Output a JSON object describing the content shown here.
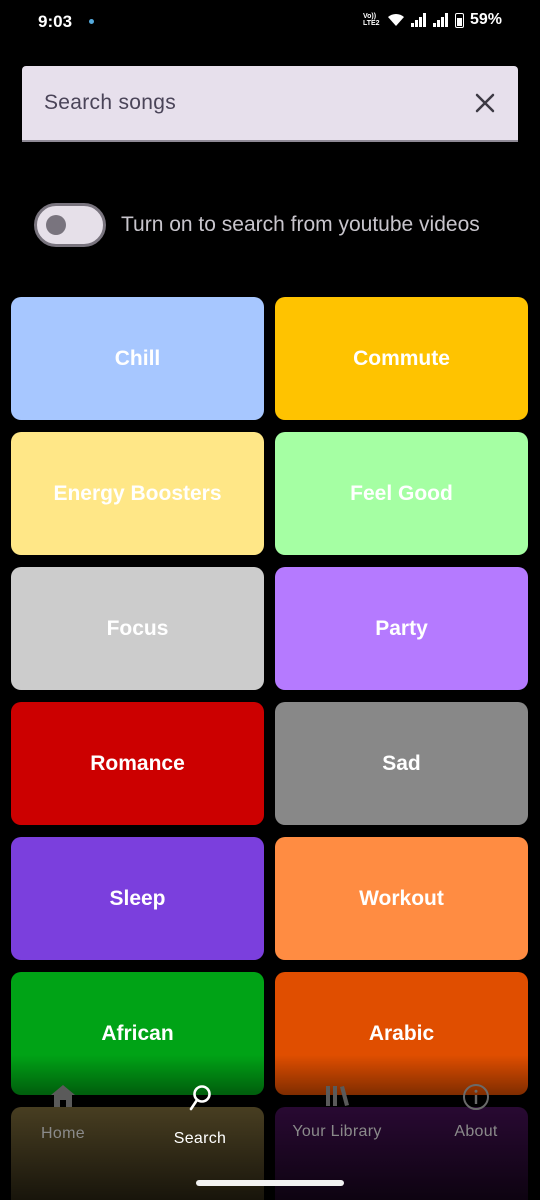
{
  "status_bar": {
    "time": "9:03",
    "network": "Vo)) LTE2",
    "battery": "59%"
  },
  "search": {
    "placeholder": "Search songs"
  },
  "youtube_toggle": {
    "label": "Turn on to search from youtube videos",
    "on": false
  },
  "genres": [
    {
      "label": "Chill",
      "color": "#a7c7ff"
    },
    {
      "label": "Commute",
      "color": "#ffc300"
    },
    {
      "label": "Energy Boosters",
      "color": "#ffe787"
    },
    {
      "label": "Feel Good",
      "color": "#a5ffa3"
    },
    {
      "label": "Focus",
      "color": "#cccccc"
    },
    {
      "label": "Party",
      "color": "#b57aff"
    },
    {
      "label": "Romance",
      "color": "#cc0000"
    },
    {
      "label": "Sad",
      "color": "#888888"
    },
    {
      "label": "Sleep",
      "color": "#7b3fdd"
    },
    {
      "label": "Workout",
      "color": "#ff8c42"
    },
    {
      "label": "African",
      "color": "#00a316"
    },
    {
      "label": "Arabic",
      "color": "#e04e00"
    },
    {
      "label": "",
      "color": "#a08a4a"
    },
    {
      "label": "",
      "color": "#5a1470"
    }
  ],
  "bottom_nav": [
    {
      "label": "Home",
      "icon": "home-icon",
      "active": false
    },
    {
      "label": "Search",
      "icon": "search-icon",
      "active": true
    },
    {
      "label": "Your Library",
      "icon": "library-icon",
      "active": false
    },
    {
      "label": "About",
      "icon": "info-icon",
      "active": false
    }
  ]
}
